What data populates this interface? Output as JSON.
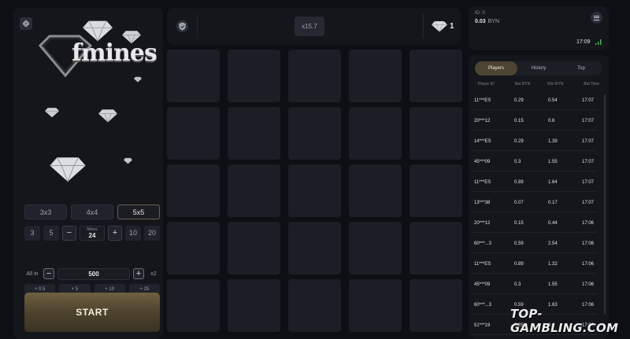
{
  "left_panel": {
    "logo_text": "fmines",
    "grid_sizes": [
      {
        "label": "3x3",
        "active": false
      },
      {
        "label": "4x4",
        "active": false
      },
      {
        "label": "5x5",
        "active": true
      }
    ],
    "mines": {
      "preset_left": [
        "3",
        "5"
      ],
      "minus": "−",
      "label": "Mines",
      "value": "24",
      "plus": "+",
      "preset_right": [
        "10",
        "20"
      ]
    },
    "bet": {
      "all_in": "All in",
      "minus": "−",
      "value": "500",
      "plus": "+",
      "double": "x2"
    },
    "quick_adds": [
      "+ 0.5",
      "+ 5",
      "+ 10",
      "+ 25"
    ],
    "start_label": "START"
  },
  "top_bar": {
    "multiplier": "x15.7",
    "diamonds_count": "1"
  },
  "board": {
    "rows": 5,
    "cols": 5
  },
  "user": {
    "id_label": "ID: 0",
    "balance": "0.03",
    "currency": "BYN",
    "time": "17:09"
  },
  "players_panel": {
    "tabs": [
      {
        "label": "Players",
        "active": true
      },
      {
        "label": "History",
        "active": false
      },
      {
        "label": "Top",
        "active": false
      }
    ],
    "columns": [
      "Player ID",
      "Bet BYN",
      "Win BYN",
      "Bet Time"
    ],
    "rows": [
      [
        "11***ES",
        "0.29",
        "0.54",
        "17:07"
      ],
      [
        "20***12",
        "0.15",
        "0.6",
        "17:07"
      ],
      [
        "14***ES",
        "0.29",
        "1.39",
        "17:07"
      ],
      [
        "45***09",
        "0.3",
        "1.55",
        "17:07"
      ],
      [
        "11***ES",
        "0.89",
        "1.64",
        "17:07"
      ],
      [
        "13***38",
        "0.07",
        "0.17",
        "17:07"
      ],
      [
        "20***12",
        "0.15",
        "0.44",
        "17:06"
      ],
      [
        "60***...3",
        "0.59",
        "2.54",
        "17:06"
      ],
      [
        "11***ES",
        "0.89",
        "1.32",
        "17:06"
      ],
      [
        "45***09",
        "0.3",
        "1.55",
        "17:06"
      ],
      [
        "60***...3",
        "0.59",
        "1.63",
        "17:06"
      ],
      [
        "51***19",
        "0.35",
        "0.4",
        "17:06"
      ]
    ]
  },
  "watermark": "TOP-GAMBLING.COM",
  "colors": {
    "background": "#0d0f14",
    "panel": "#14161c",
    "cell": "#1b1e25",
    "gold_accent": "#4d4433",
    "start_button": "#5a4f36"
  }
}
